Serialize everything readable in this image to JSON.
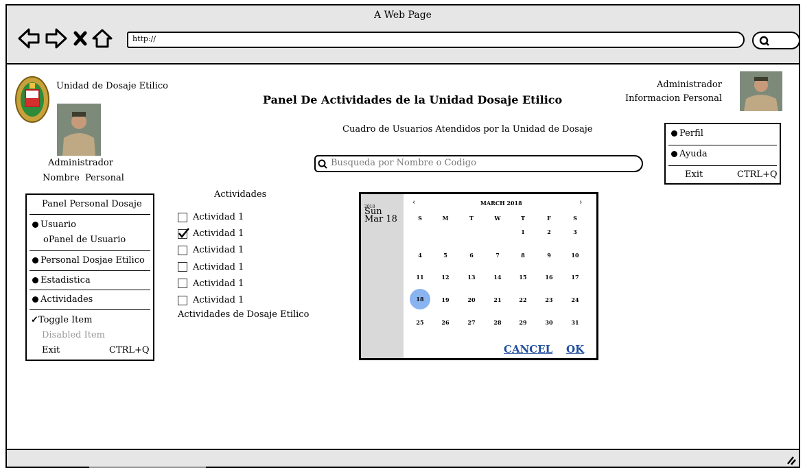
{
  "window": {
    "title": "A Web Page",
    "url": "http://"
  },
  "header": {
    "org_name": "Unidad de Dosaje Etilico",
    "panel_title": "Panel De Actividades de la Unidad Dosaje Etilico",
    "subtitle": "Cuadro de Usuarios Atendidos por la Unidad de Dosaje",
    "search_placeholder": "Busqueda por Nombre o Codigo",
    "admin_role": "Administrador",
    "admin_info": "Informacion Personal"
  },
  "profile_left": {
    "role": "Administrador",
    "name": "Nombre  Personal"
  },
  "user_menu": {
    "items": [
      "Perfil",
      "Ayuda"
    ],
    "exit_label": "Exit",
    "exit_shortcut": "CTRL+Q"
  },
  "side_menu": {
    "header": "Panel Personal Dosaje",
    "usuario": "Usuario",
    "panel_usuario": "oPanel de Usuario",
    "personal": "Personal Dosjae Etilico",
    "estadistica": "Estadistica",
    "actividades": "Actividades",
    "toggle": "Toggle Item",
    "disabled": "Disabled Item",
    "exit_label": "Exit",
    "exit_shortcut": "CTRL+Q"
  },
  "activities": {
    "title": "Actividades",
    "items": [
      {
        "label": "Actividad 1",
        "checked": false
      },
      {
        "label": "Actividad 1",
        "checked": true
      },
      {
        "label": "Actividad 1",
        "checked": false
      },
      {
        "label": "Actividad 1",
        "checked": false
      },
      {
        "label": "Actividad 1",
        "checked": false
      },
      {
        "label": "Actividad 1",
        "checked": false
      }
    ],
    "footer": "Actividades de Dosaje Etilico"
  },
  "calendar": {
    "side_year": "2018",
    "side_weekday": "Sun",
    "side_date": "Mar 18",
    "month_label": "MARCH 2018",
    "prev": "‹",
    "next": "›",
    "weekdays": [
      "S",
      "M",
      "T",
      "W",
      "T",
      "F",
      "S"
    ],
    "weeks": [
      [
        "",
        "",
        "",
        "",
        "1",
        "2",
        "3"
      ],
      [
        "4",
        "5",
        "6",
        "7",
        "8",
        "9",
        "10"
      ],
      [
        "11",
        "12",
        "13",
        "14",
        "15",
        "16",
        "17"
      ],
      [
        "18",
        "19",
        "20",
        "21",
        "22",
        "23",
        "24"
      ],
      [
        "25",
        "26",
        "27",
        "28",
        "29",
        "30",
        "31"
      ]
    ],
    "selected": "18",
    "cancel": "CANCEL",
    "ok": "OK"
  },
  "colors": {
    "accent": "#1f4e9e",
    "selected_day": "#8ab4f0",
    "chrome": "#e6e6e6"
  }
}
